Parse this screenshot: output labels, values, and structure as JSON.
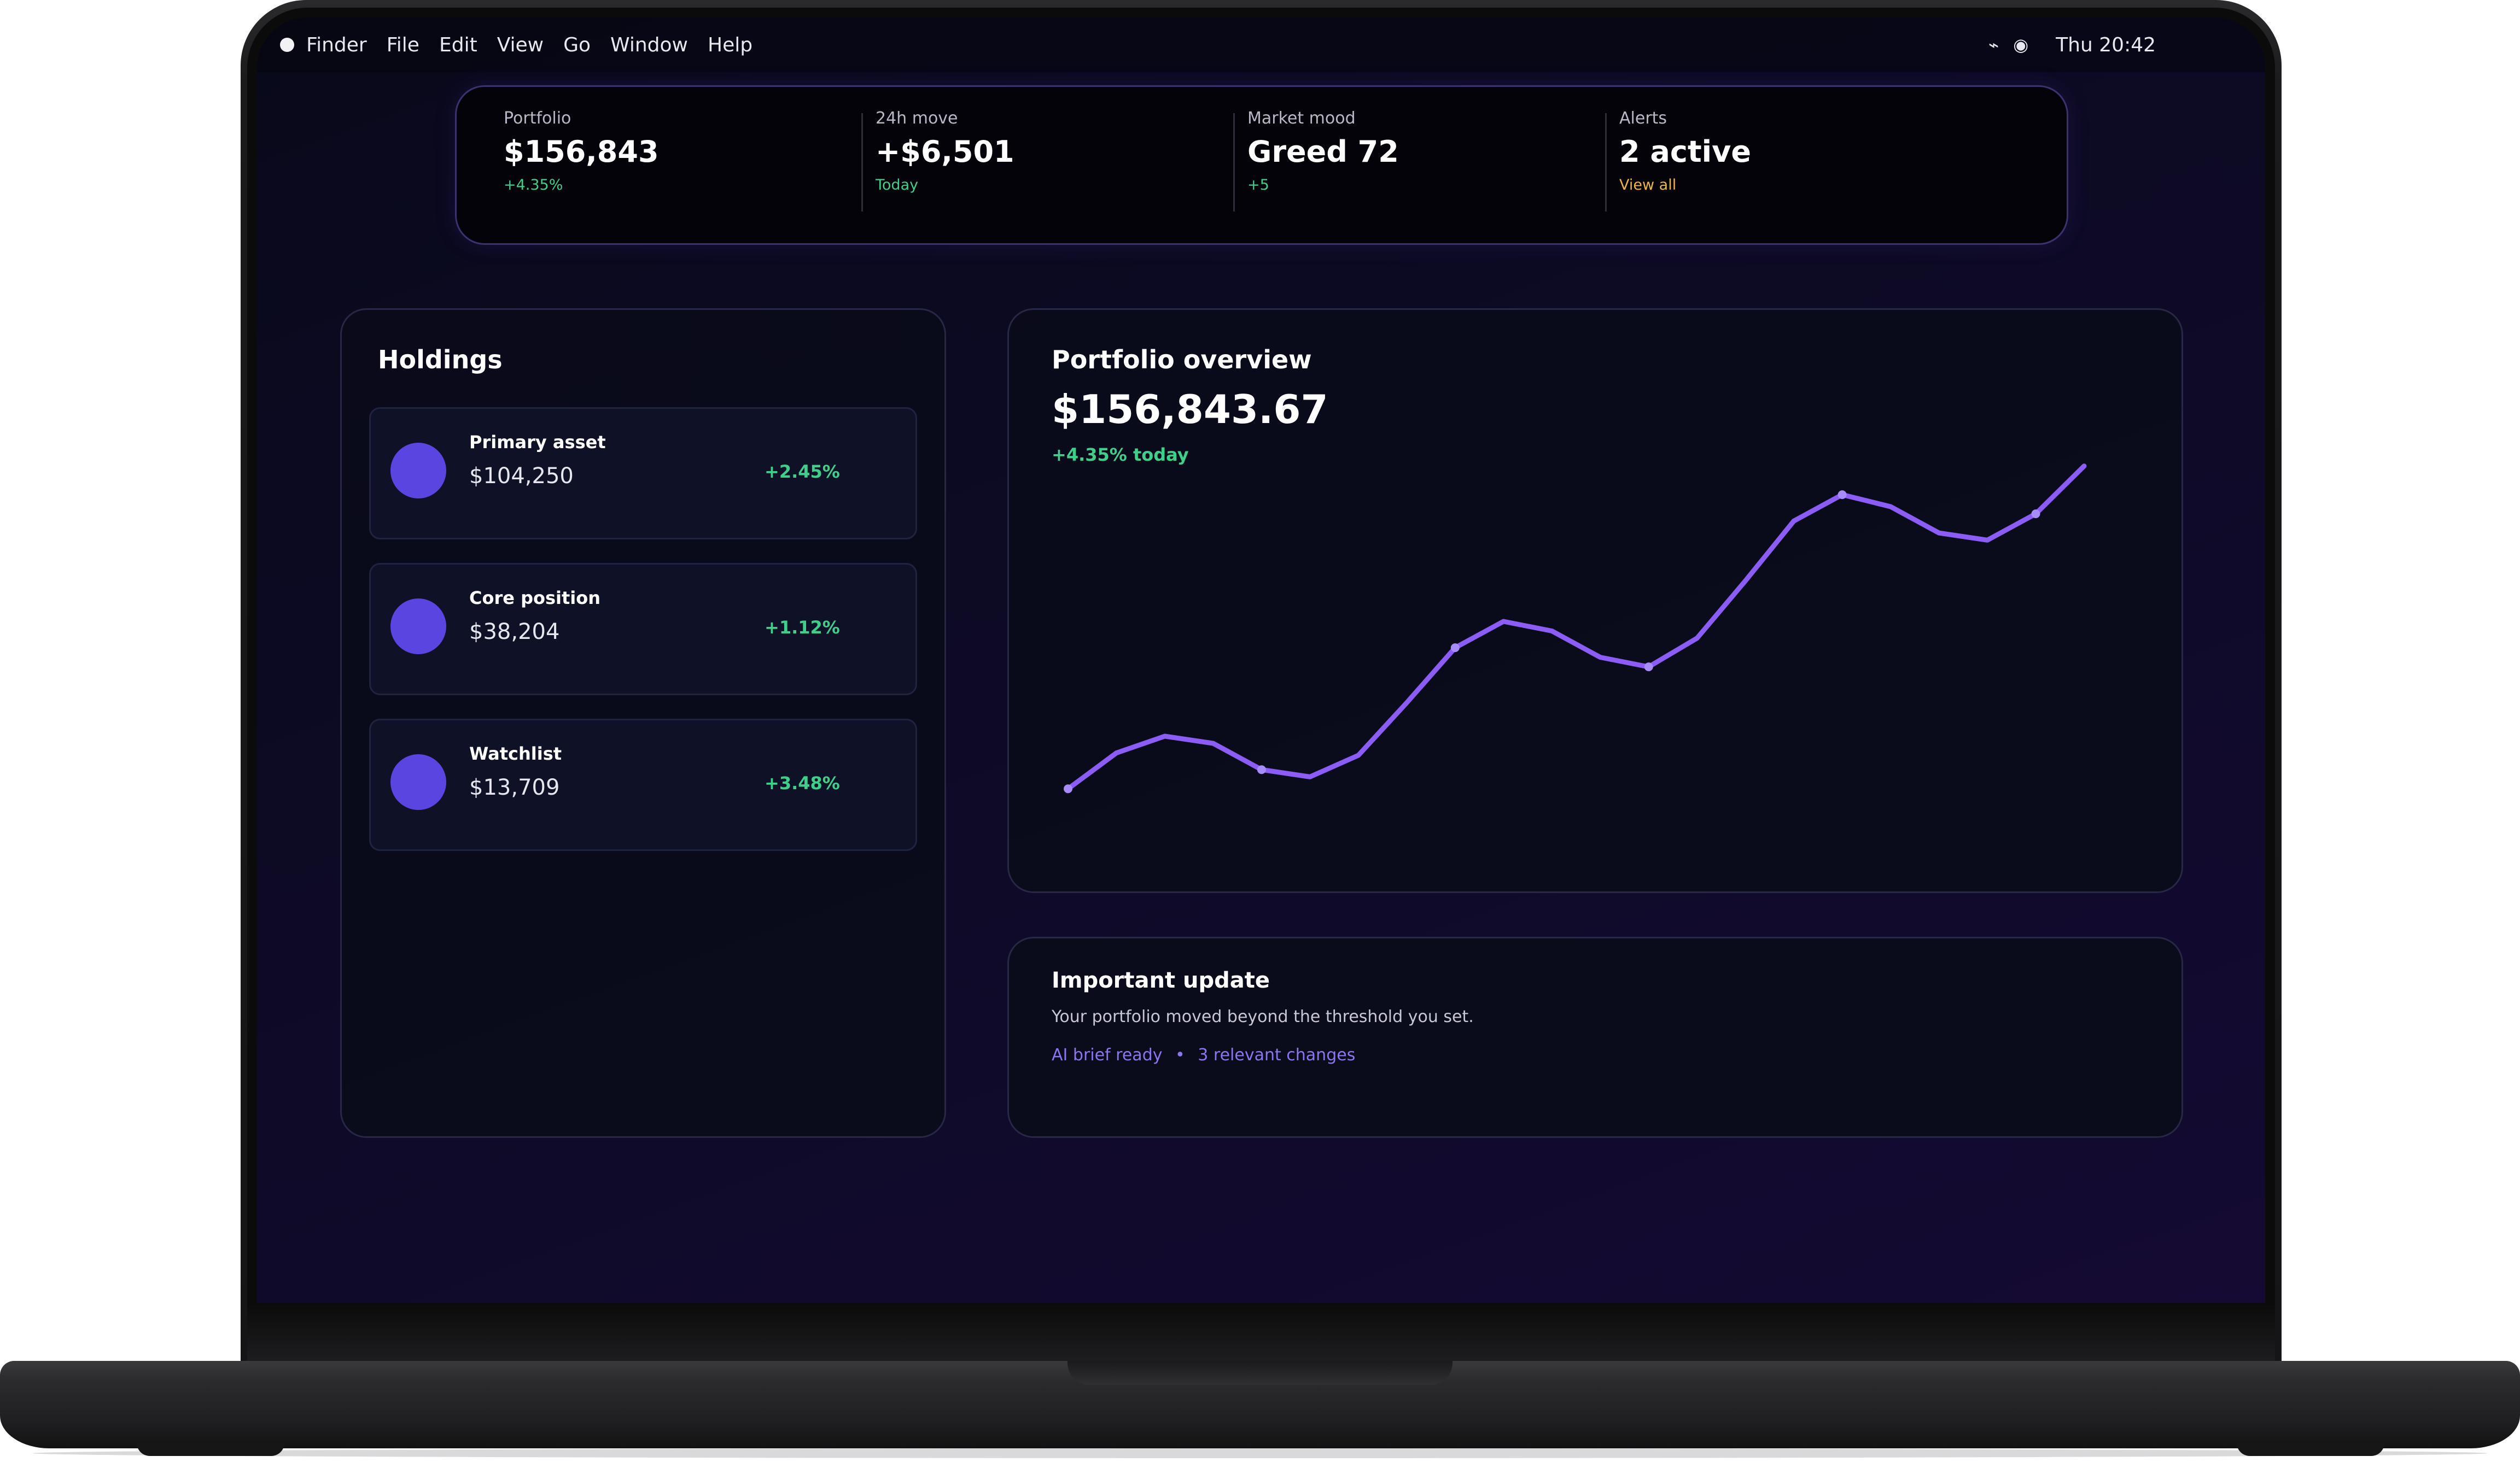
{
  "menubar": {
    "items": [
      "Finder",
      "File",
      "Edit",
      "View",
      "Go",
      "Window",
      "Help"
    ],
    "clock": "Thu 20:42"
  },
  "stats": [
    {
      "label": "Portfolio",
      "value": "$156,843",
      "sub": "+4.35%",
      "sub_color": "#3ed08a"
    },
    {
      "label": "24h move",
      "value": "+$6,501",
      "sub": "Today",
      "sub_color": "#3ed08a"
    },
    {
      "label": "Market mood",
      "value": "Greed 72",
      "sub": "+5",
      "sub_color": "#3ed08a"
    },
    {
      "label": "Alerts",
      "value": "2 active",
      "sub": "View all",
      "sub_color": "#f0b441"
    }
  ],
  "holdings": {
    "title": "Holdings",
    "items": [
      {
        "name": "Primary asset",
        "amount": "$104,250",
        "change": "+2.45%"
      },
      {
        "name": "Core position",
        "amount": "$38,204",
        "change": "+1.12%"
      },
      {
        "name": "Watchlist",
        "amount": "$13,709",
        "change": "+3.48%"
      }
    ]
  },
  "overview": {
    "title": "Portfolio overview",
    "value": "$156,843.67",
    "change": "+4.35% today"
  },
  "update": {
    "title": "Important update",
    "body": "Your portfolio moved beyond the threshold you set.",
    "tag1": "AI brief ready",
    "separator": "•",
    "tag2": "3 relevant changes"
  },
  "colors": {
    "accent": "#8b5cf6",
    "positive": "#3ed08a",
    "warning": "#f0b441",
    "holding_dot": "#5b45e0"
  },
  "chart_data": {
    "type": "line",
    "title": "",
    "xlabel": "",
    "ylabel": "",
    "grid": false,
    "x": [
      0,
      1,
      2,
      3,
      4,
      5,
      6,
      7,
      8,
      9,
      10,
      11,
      12,
      13,
      14,
      15,
      16,
      17,
      18,
      19,
      20,
      21
    ],
    "series": [
      {
        "values": [
          5.0,
          12.5,
          16.0,
          14.5,
          9.0,
          7.5,
          12.0,
          23.0,
          34.5,
          40.0,
          38.0,
          32.5,
          30.5,
          36.5,
          48.5,
          61.0,
          66.5,
          64.0,
          58.5,
          57.0,
          62.5,
          72.5
        ],
        "markers": [
          0,
          4,
          8,
          12,
          16,
          20
        ]
      }
    ],
    "ylim": [
      0,
      80
    ]
  }
}
